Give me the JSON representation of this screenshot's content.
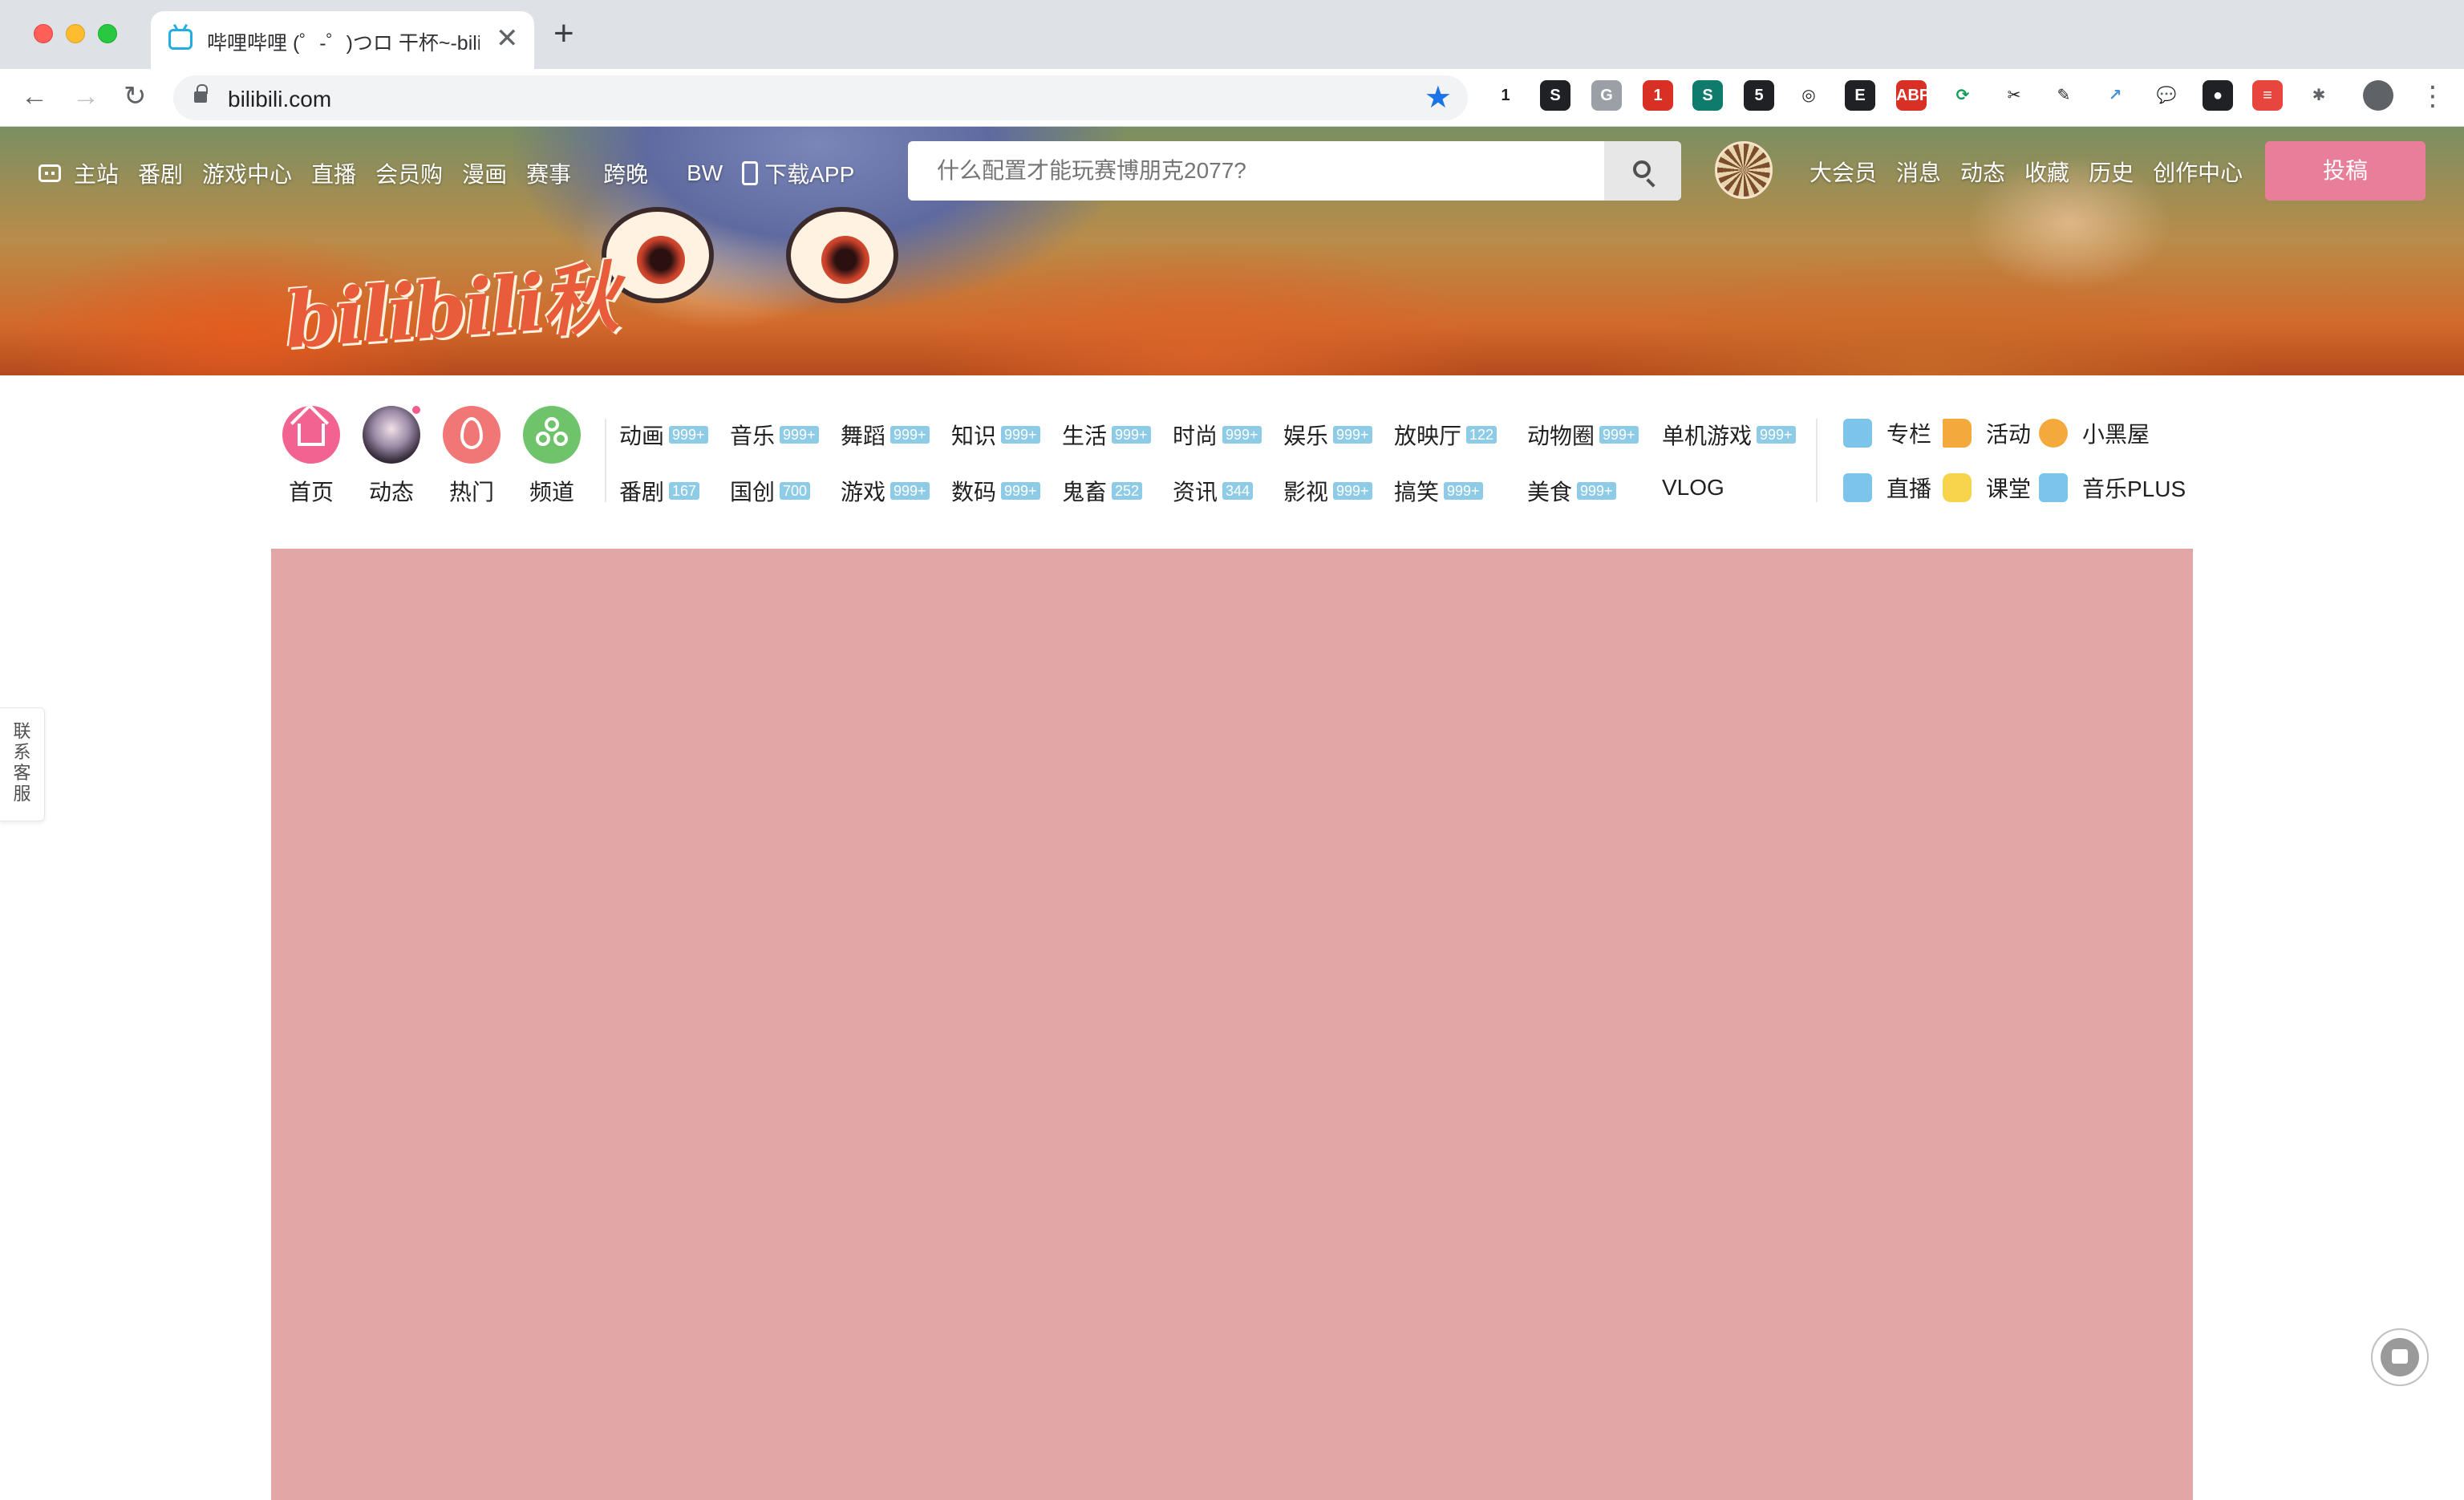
{
  "browser": {
    "tab_title": "哔哩哔哩 (゜-゜)つロ 干杯~-bili",
    "tab_close": "✕",
    "new_tab": "+",
    "back": "←",
    "forward": "→",
    "reload": "↻",
    "url": "bilibili.com",
    "star": "★",
    "menu": "⋮",
    "extensions": [
      {
        "icon": "one-icon",
        "text": "1",
        "color": "#ffffff",
        "fg": "#202124"
      },
      {
        "icon": "s-circle-icon",
        "text": "S",
        "color": "#202124",
        "fg": "#ffffff"
      },
      {
        "icon": "grammar-icon",
        "text": "G",
        "color": "#9aa0a6",
        "fg": "#ffffff"
      },
      {
        "icon": "todo-icon",
        "text": "1",
        "color": "#d93025",
        "fg": "#ffffff"
      },
      {
        "icon": "s-square-icon",
        "text": "S",
        "color": "#0f7b6c",
        "fg": "#ffffff"
      },
      {
        "icon": "camera-icon",
        "text": "5",
        "color": "#202124",
        "fg": "#ffffff"
      },
      {
        "icon": "chrome-ball-icon",
        "text": "◎",
        "color": "#ffffff",
        "fg": "#202124"
      },
      {
        "icon": "e-circle-icon",
        "text": "E",
        "color": "#202124",
        "fg": "#ffffff"
      },
      {
        "icon": "adblock-icon",
        "text": "ABP",
        "color": "#d93025",
        "fg": "#ffffff"
      },
      {
        "icon": "translate-icon",
        "text": "⟳",
        "color": "#ffffff",
        "fg": "#0f9d58"
      },
      {
        "icon": "scissors-icon",
        "text": "✂",
        "color": "#ffffff",
        "fg": "#202124"
      },
      {
        "icon": "pencil-icon",
        "text": "✎",
        "color": "#ffffff",
        "fg": "#202124"
      },
      {
        "icon": "share-icon",
        "text": "↗",
        "color": "#ffffff",
        "fg": "#4a90d9"
      },
      {
        "icon": "chat-icon",
        "text": "💬",
        "color": "#ffffff",
        "fg": "#202124"
      },
      {
        "icon": "bird-icon",
        "text": "●",
        "color": "#202124",
        "fg": "#ffffff"
      },
      {
        "icon": "notes-icon",
        "text": "≡",
        "color": "#e8453c",
        "fg": "#ffffff"
      },
      {
        "icon": "puzzle-icon",
        "text": "✱",
        "color": "#ffffff",
        "fg": "#5f6368"
      },
      {
        "icon": "profile-icon",
        "text": "",
        "color": "#5f6368",
        "fg": "#ffffff"
      }
    ]
  },
  "header": {
    "nav": [
      "主站",
      "番剧",
      "游戏中心",
      "直播",
      "会员购",
      "漫画",
      "赛事",
      "跨晚",
      "BW",
      "下载APP"
    ],
    "search_placeholder": "什么配置才能玩赛博朋克2077?",
    "user_nav": [
      "大会员",
      "消息",
      "动态",
      "收藏",
      "历史",
      "创作中心"
    ],
    "upload_label": "投稿",
    "logo_text": "bilibili秋"
  },
  "primary_nav": {
    "circles": [
      {
        "label": "首页",
        "color": "#f36392",
        "icon": "home-icon"
      },
      {
        "label": "动态",
        "color": "#3a3040",
        "icon": "dynamic-avatar-icon"
      },
      {
        "label": "热门",
        "color": "#f07775",
        "icon": "flame-icon"
      },
      {
        "label": "频道",
        "color": "#6fc36a",
        "icon": "channel-icon"
      }
    ],
    "row1": [
      {
        "name": "动画",
        "count": "999+"
      },
      {
        "name": "音乐",
        "count": "999+"
      },
      {
        "name": "舞蹈",
        "count": "999+"
      },
      {
        "name": "知识",
        "count": "999+"
      },
      {
        "name": "生活",
        "count": "999+"
      },
      {
        "name": "时尚",
        "count": "999+"
      },
      {
        "name": "娱乐",
        "count": "999+"
      },
      {
        "name": "放映厅",
        "count": "122"
      },
      {
        "name": "动物圈",
        "count": "999+"
      },
      {
        "name": "单机游戏",
        "count": "999+"
      }
    ],
    "row2": [
      {
        "name": "番剧",
        "count": "167"
      },
      {
        "name": "国创",
        "count": "700"
      },
      {
        "name": "游戏",
        "count": "999+"
      },
      {
        "name": "数码",
        "count": "999+"
      },
      {
        "name": "鬼畜",
        "count": "252"
      },
      {
        "name": "资讯",
        "count": "344"
      },
      {
        "name": "影视",
        "count": "999+"
      },
      {
        "name": "搞笑",
        "count": "999+"
      },
      {
        "name": "美食",
        "count": "999+"
      },
      {
        "name": "VLOG",
        "count": ""
      }
    ],
    "side_links": [
      {
        "label": "专栏",
        "icon": "column-icon",
        "color": "#7cc4e9"
      },
      {
        "label": "活动",
        "icon": "flag-icon",
        "color": "#f4a93c"
      },
      {
        "label": "小黑屋",
        "icon": "scale-icon",
        "color": "#f4a93c"
      },
      {
        "label": "直播",
        "icon": "live-icon",
        "color": "#7cc4e9"
      },
      {
        "label": "课堂",
        "icon": "classroom-icon",
        "color": "#f7d44c"
      },
      {
        "label": "音乐PLUS",
        "icon": "music-plus-icon",
        "color": "#7cc4e9"
      }
    ]
  },
  "sidebar": {
    "contact": [
      "联",
      "系",
      "客",
      "服"
    ]
  },
  "colors": {
    "placeholder_block": "#e1a6a5",
    "upload_button": "#e87e98",
    "badge": "#8ecbe7"
  }
}
